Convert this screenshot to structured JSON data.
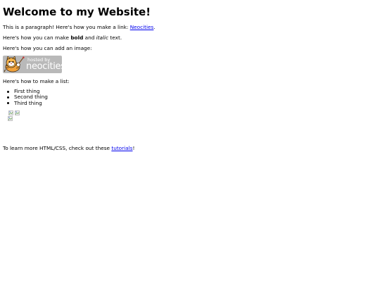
{
  "heading": "Welcome to my Website!",
  "p1": {
    "before": "This is a paragraph! Here's how you make a link: ",
    "link": "Neocities",
    "after": "."
  },
  "p2": {
    "before": "Here's how you can make ",
    "bold": "bold",
    "middle": " and ",
    "italic": "italic",
    "after": " text."
  },
  "p3": "Here's how you can add an image:",
  "badge": {
    "hosted_by": "hosted by",
    "brand": "neocities",
    "bg_color": "#b9b9b9"
  },
  "p4": "Here's how to make a list:",
  "list_items": [
    "First thing",
    "Second thing",
    "Third thing"
  ],
  "p5": {
    "before": "To learn more HTML/CSS, check out these ",
    "link": "tutorials",
    "after": "!"
  },
  "colors": {
    "link": "#0000ee",
    "text": "#000000"
  },
  "icons": [
    "neocities-cat-icon",
    "broken-image-icon"
  ]
}
